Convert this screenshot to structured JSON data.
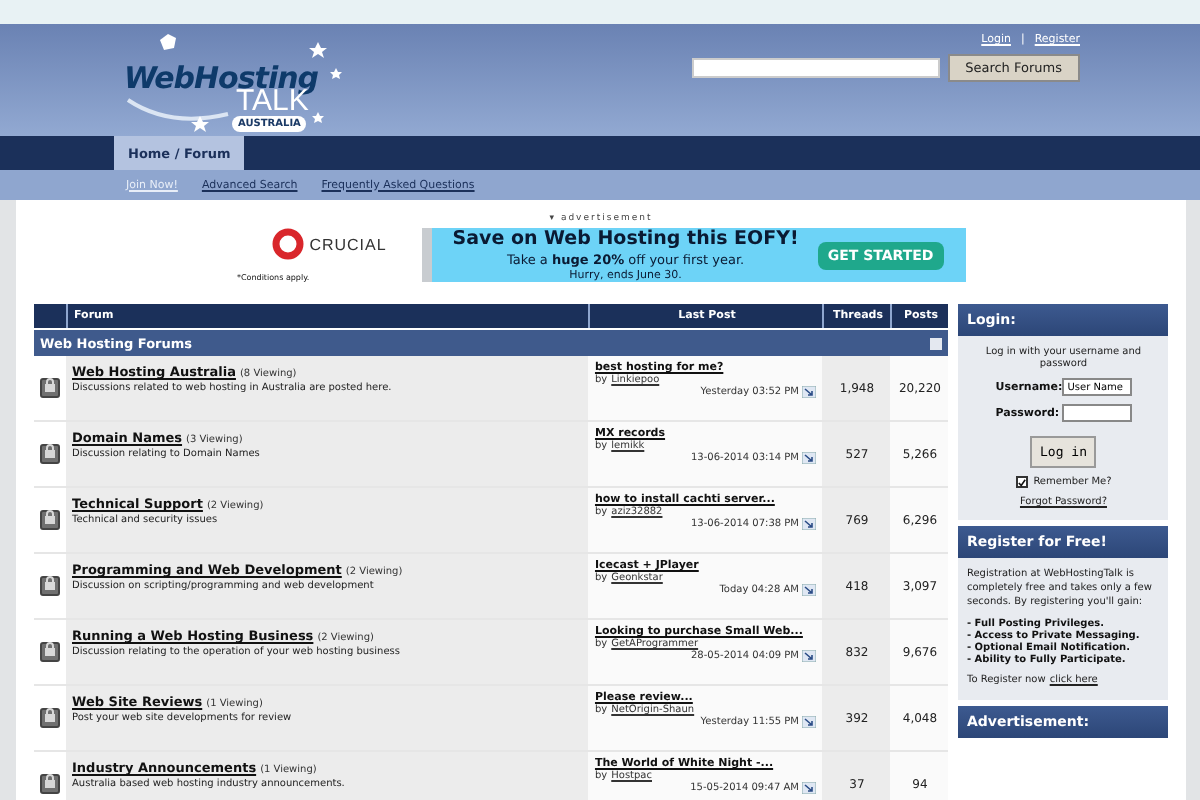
{
  "header": {
    "logo": {
      "line1": "WebHosting",
      "line2": "TALK",
      "line3": "AUSTRALIA"
    },
    "links": [
      "Login",
      "Register"
    ],
    "separator": "|",
    "search_button": "Search Forums"
  },
  "nav": {
    "tabs": [
      {
        "label": "Home / Forum",
        "selected": true
      }
    ],
    "links": [
      {
        "label": "Join Now!",
        "kind": "join"
      },
      {
        "label": "Advanced Search",
        "kind": "link"
      },
      {
        "label": "Frequently Asked Questions",
        "kind": "link"
      }
    ]
  },
  "ad": {
    "label": "▾ advertisement",
    "brand": "CRUCIAL",
    "conditions": "*Conditions apply.",
    "headline": "Save on Web Hosting this EOFY!",
    "offer": "Take a **huge 20%** off your first year.",
    "deadline": "Hurry, ends June 30.",
    "cta": "GET STARTED"
  },
  "forum_table": {
    "columns": [
      "Forum",
      "Last Post",
      "Threads",
      "Posts"
    ],
    "category": "Web Hosting Forums",
    "rows": [
      {
        "title": "Web Hosting Australia",
        "viewing": "(8 Viewing)",
        "description": "Discussions related to web hosting in Australia are posted here.",
        "last_title": "best hosting for me?",
        "by": "by",
        "author": "Linkiepoo",
        "time": "Yesterday 03:52 PM",
        "threads": "1,948",
        "posts": "20,220"
      },
      {
        "title": "Domain Names",
        "viewing": "(3 Viewing)",
        "description": "Discussion relating to Domain Names",
        "last_title": "MX records",
        "by": "by",
        "author": "lemikk",
        "time": "13-06-2014 03:14 PM",
        "threads": "527",
        "posts": "5,266"
      },
      {
        "title": "Technical Support",
        "viewing": "(2 Viewing)",
        "description": "Technical and security issues",
        "last_title": "how to install cachti server...",
        "by": "by",
        "author": "aziz32882",
        "time": "13-06-2014 07:38 PM",
        "threads": "769",
        "posts": "6,296"
      },
      {
        "title": "Programming and Web Development",
        "viewing": "(2 Viewing)",
        "description": "Discussion on scripting/programming and web development",
        "last_title": "Icecast + JPlayer",
        "by": "by",
        "author": "Geonkstar",
        "time": "Today 04:28 AM",
        "threads": "418",
        "posts": "3,097"
      },
      {
        "title": "Running a Web Hosting Business",
        "viewing": "(2 Viewing)",
        "description": "Discussion relating to the operation of your web hosting business",
        "last_title": "Looking to purchase Small Web...",
        "by": "by",
        "author": "GetAProgrammer",
        "time": "28-05-2014 04:09 PM",
        "threads": "832",
        "posts": "9,676"
      },
      {
        "title": "Web Site Reviews",
        "viewing": "(1 Viewing)",
        "description": "Post your web site developments for review",
        "last_title": "Please review...",
        "by": "by",
        "author": "NetOrigin-Shaun",
        "time": "Yesterday 11:55 PM",
        "threads": "392",
        "posts": "4,048"
      },
      {
        "title": "Industry Announcements",
        "viewing": "(1 Viewing)",
        "description": "Australia based web hosting industry announcements.",
        "last_title": "The World of White Night -...",
        "by": "by",
        "author": "Hostpac",
        "time": "15-05-2014 09:47 AM",
        "threads": "37",
        "posts": "94"
      }
    ]
  },
  "sidebar": {
    "login": {
      "title": "Login:",
      "intro": "Log in with your username and password",
      "username_label": "Username:",
      "username_value": "User Name",
      "password_label": "Password:",
      "button": "Log in",
      "remember": "Remember Me?",
      "remember_checked": true,
      "forgot": "Forgot Password?"
    },
    "register": {
      "title": "Register for Free!",
      "text": "Registration at WebHostingTalk is completely free and takes only a few seconds. By registering you'll gain:",
      "benefits": [
        "- Full Posting Privileges.",
        "- Access to Private Messaging.",
        "- Optional Email Notification.",
        "- Ability to Fully Participate."
      ],
      "footer": "To Register now",
      "link": "click here"
    },
    "ad_title": "Advertisement:"
  }
}
